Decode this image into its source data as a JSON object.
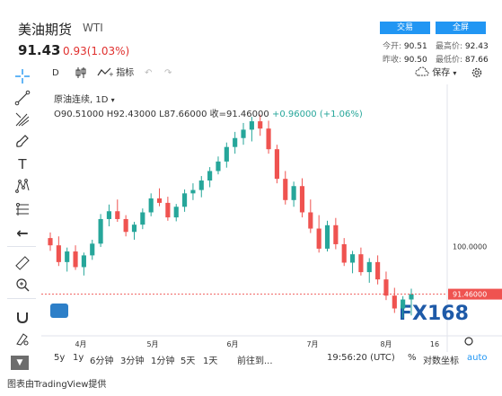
{
  "header": {
    "title": "美油期货",
    "symbol": "WTI",
    "price": "91.43",
    "change": "0.93(1.03%)",
    "trade_label": "交易",
    "fullscreen_label": "全屏",
    "stats": [
      {
        "label": "今开:",
        "value": "90.51"
      },
      {
        "label": "最高价:",
        "value": "92.43"
      },
      {
        "label": "昨收:",
        "value": "90.50"
      },
      {
        "label": "最低价:",
        "value": "87.66"
      }
    ]
  },
  "toolbar": {
    "interval": "D",
    "indicators_label": "指标",
    "save_label": "保存"
  },
  "legend": {
    "symbol_line": "原油连续, 1D",
    "ohlc": "O90.51000 H92.43000 L87.66000 收=91.46000",
    "change": "+0.96000 (+1.06%)"
  },
  "chart_data": {
    "type": "candlestick",
    "x_ticks": [
      "4月",
      "5月",
      "6月",
      "7月",
      "8月",
      "16"
    ],
    "y_ticks": [
      "100.0000"
    ],
    "last_price_label": "91.46000",
    "watermark": "FX168",
    "ylim": [
      84,
      129
    ],
    "series": [
      {
        "name": "原油连续",
        "values": [
          [
            101.5,
            102.5,
            99.2,
            100.2
          ],
          [
            100.2,
            101.8,
            96.5,
            97.2
          ],
          [
            97.2,
            99.8,
            95.5,
            99.1
          ],
          [
            99.1,
            100.2,
            95.8,
            96.3
          ],
          [
            96.3,
            98.9,
            94.8,
            98.4
          ],
          [
            98.4,
            101.2,
            97.6,
            100.5
          ],
          [
            100.5,
            105.8,
            99.9,
            104.9
          ],
          [
            104.9,
            107.5,
            103.6,
            106.3
          ],
          [
            106.3,
            108.4,
            104.4,
            104.9
          ],
          [
            104.9,
            105.6,
            101.8,
            102.6
          ],
          [
            102.6,
            104.4,
            101.2,
            103.9
          ],
          [
            103.9,
            106.8,
            103.1,
            106.1
          ],
          [
            106.1,
            109.5,
            105.4,
            108.6
          ],
          [
            108.6,
            110.4,
            107.2,
            107.8
          ],
          [
            107.8,
            108.9,
            104.6,
            105.2
          ],
          [
            105.2,
            107.6,
            104.5,
            107.1
          ],
          [
            107.1,
            110.2,
            106.2,
            109.5
          ],
          [
            109.5,
            111.3,
            108.3,
            110.1
          ],
          [
            110.1,
            112.6,
            108.8,
            111.8
          ],
          [
            111.8,
            114.2,
            110.6,
            113.5
          ],
          [
            113.5,
            116.1,
            112.9,
            115.2
          ],
          [
            115.2,
            118.6,
            114.1,
            117.8
          ],
          [
            117.8,
            120.5,
            116.6,
            119.4
          ],
          [
            119.4,
            122.1,
            118.2,
            120.9
          ],
          [
            120.9,
            123.2,
            118.8,
            122.4
          ],
          [
            122.4,
            123.6,
            119.8,
            121.1
          ],
          [
            121.1,
            122.5,
            116.6,
            117.4
          ],
          [
            117.4,
            118.2,
            111.3,
            112.1
          ],
          [
            112.1,
            113.5,
            107.5,
            108.3
          ],
          [
            108.3,
            111.6,
            107.1,
            110.8
          ],
          [
            110.8,
            112.2,
            105.2,
            106.1
          ],
          [
            106.1,
            108.4,
            102.4,
            103.2
          ],
          [
            103.2,
            105.6,
            98.9,
            99.6
          ],
          [
            99.6,
            104.6,
            99.1,
            103.8
          ],
          [
            103.8,
            105.1,
            99.5,
            100.4
          ],
          [
            100.4,
            101.5,
            96.5,
            97.1
          ],
          [
            97.1,
            99.2,
            95.2,
            98.6
          ],
          [
            98.6,
            99.8,
            94.8,
            95.4
          ],
          [
            95.4,
            97.9,
            93.5,
            97.2
          ],
          [
            97.2,
            98.4,
            93.2,
            94.1
          ],
          [
            94.1,
            95.5,
            90.4,
            91.2
          ],
          [
            91.2,
            92.6,
            88.1,
            88.9
          ],
          [
            88.9,
            91.1,
            87.2,
            90.5
          ],
          [
            90.51,
            92.43,
            87.66,
            91.46
          ]
        ]
      }
    ]
  },
  "bottom_bar": {
    "ranges": [
      "5y",
      "1y",
      "6分钟",
      "3分钟",
      "1分钟",
      "5天",
      "1天"
    ],
    "goto_label": "前往到...",
    "time": "19:56:20 (UTC)",
    "percent_label": "%",
    "log_label": "对数坐标",
    "auto_label": "auto"
  },
  "footer": {
    "text": "图表由TradingView提供"
  },
  "colors": {
    "up": "#26a69a",
    "down": "#ef5350",
    "accent": "#2196f3",
    "neg_change": "#e0302e"
  },
  "icons": [
    "crosshair-icon",
    "trend-line-icon",
    "fib-icon",
    "brush-icon",
    "text-icon",
    "pattern-icon",
    "projection-icon",
    "back-arrow-icon",
    "ruler-icon",
    "zoom-in-icon",
    "magnet-icon",
    "lock-draw-icon",
    "lock-icon",
    "trash-icon",
    "undo-icon",
    "redo-icon",
    "cloud-save-icon",
    "settings-icon",
    "candles-icon",
    "chevron-down-icon"
  ]
}
